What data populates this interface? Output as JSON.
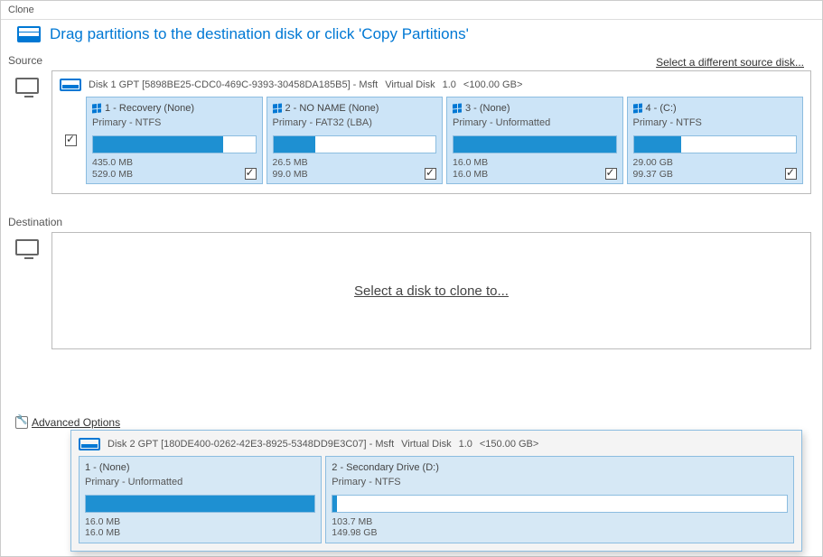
{
  "tab": "Clone",
  "instruction": "Drag partitions to the destination disk or click 'Copy Partitions'",
  "sourceLabel": "Source",
  "destLabel": "Destination",
  "sourceLink": "Select a different source disk...",
  "destPlaceholder": "Select a disk to clone to...",
  "advanced": "Advanced Options",
  "sourceDisk": {
    "name": "Disk 1 GPT [5898BE25-CDC0-469C-9393-30458DA185B5] - Msft",
    "type": "Virtual Disk",
    "version": "1.0",
    "capacity": "<100.00 GB>",
    "partitions": [
      {
        "idx": "1 - Recovery (None)",
        "sub": "Primary - NTFS",
        "used": "435.0 MB",
        "total": "529.0 MB",
        "fillPct": 80
      },
      {
        "idx": "2 - NO NAME (None)",
        "sub": "Primary - FAT32 (LBA)",
        "used": "26.5 MB",
        "total": "99.0 MB",
        "fillPct": 26
      },
      {
        "idx": "3 -  (None)",
        "sub": "Primary - Unformatted",
        "used": "16.0 MB",
        "total": "16.0 MB",
        "fillPct": 100
      },
      {
        "idx": "4 -  (C:)",
        "sub": "Primary - NTFS",
        "used": "29.00 GB",
        "total": "99.37 GB",
        "fillPct": 29
      }
    ]
  },
  "disk2": {
    "name": "Disk 2 GPT [180DE400-0262-42E3-8925-5348DD9E3C07] - Msft",
    "type": "Virtual Disk",
    "version": "1.0",
    "capacity": "<150.00 GB>",
    "partitions": [
      {
        "idx": "1 -  (None)",
        "sub": "Primary - Unformatted",
        "used": "16.0 MB",
        "total": "16.0 MB",
        "fillPct": 100
      },
      {
        "idx": "2 - Secondary Drive (D:)",
        "sub": "Primary - NTFS",
        "used": "103.7 MB",
        "total": "149.98 GB",
        "fillPct": 1
      }
    ]
  },
  "colors": {
    "accent": "#0078d4",
    "partBg": "#cce4f7"
  }
}
